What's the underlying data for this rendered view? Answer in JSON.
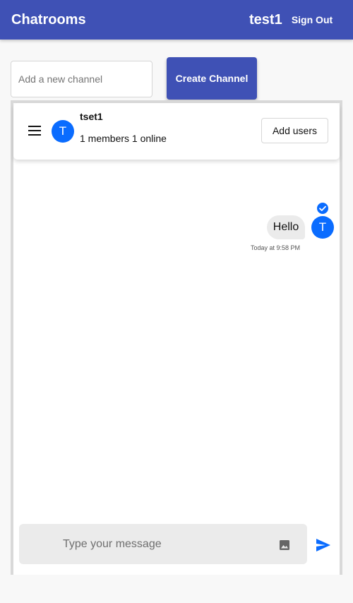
{
  "app": {
    "title": "Chatrooms",
    "username": "test1",
    "sign_out_label": "Sign Out",
    "brand_color": "#3f51b5"
  },
  "channel_form": {
    "placeholder": "Add a new channel",
    "value": "",
    "create_label": "Create Channel"
  },
  "chat_header": {
    "menu_icon": "hamburger-menu-icon",
    "avatar_letter": "T",
    "channel_name": "tset1",
    "meta": "1 members 1 online",
    "add_users_label": "Add users"
  },
  "messages": [
    {
      "text": "Hello",
      "time": "Today at 9:58 PM",
      "avatar_letter": "T",
      "status_icon": "read-check-icon"
    }
  ],
  "composer": {
    "placeholder": "Type your message",
    "value": "",
    "image_icon": "image-icon",
    "send_icon": "send-icon"
  },
  "colors": {
    "accent_blue": "#0a6cff",
    "bubble": "#ebebeb"
  }
}
